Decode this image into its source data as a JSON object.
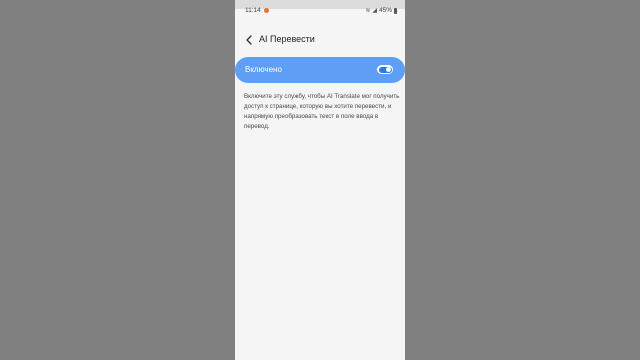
{
  "status_bar": {
    "time": "11:14",
    "battery": "45%",
    "wifi_icon": "wifi-icon",
    "signal_icon": "signal-icon",
    "notification_color": "#e8703a"
  },
  "header": {
    "back_icon": "back-arrow-icon",
    "title": "AI Перевести"
  },
  "toggle": {
    "label": "Включено",
    "state": "on",
    "background_color": "#5f9ef5",
    "switch_color": "#2f7ae5"
  },
  "description": "Включите эту службу, чтобы AI Translate мог получить доступ к странице, которую вы хотите перевести, и напрямую преобразовать текст в поле ввода в перевод."
}
